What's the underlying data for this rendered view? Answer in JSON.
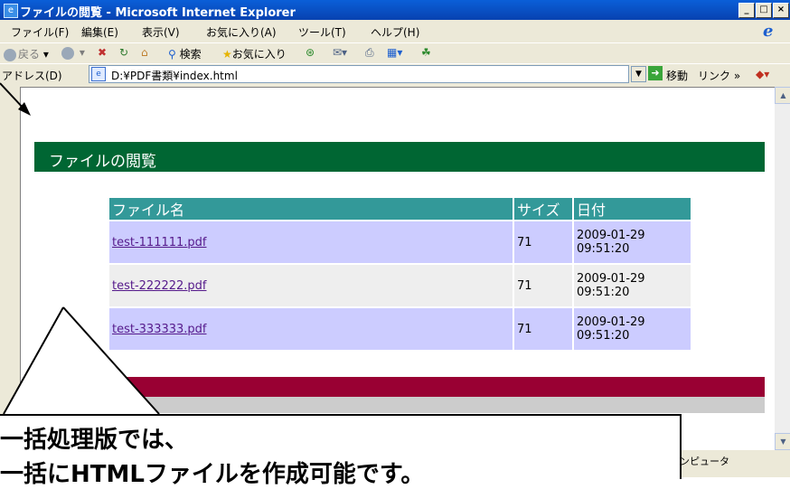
{
  "window": {
    "title": "ファイルの閲覧 - Microsoft Internet Explorer",
    "controls": [
      "_",
      "□",
      "×"
    ]
  },
  "menu": [
    "ファイル(F)",
    "編集(E)",
    "表示(V)",
    "お気に入り(A)",
    "ツール(T)",
    "ヘルプ(H)"
  ],
  "toolbar": {
    "back": "戻る",
    "search": "検索",
    "favorites": "お気に入り"
  },
  "address": {
    "label": "アドレス(D)",
    "url": "D:¥PDF書類¥index.html",
    "go": "移動",
    "links": "リンク »"
  },
  "page": {
    "heading": "ファイルの閲覧",
    "columns": [
      "ファイル名",
      "サイズ",
      "日付"
    ],
    "rows": [
      {
        "name": "test-111111.pdf",
        "size": "71",
        "date": "2009-01-29",
        "time": "09:51:20"
      },
      {
        "name": "test-222222.pdf",
        "size": "71",
        "date": "2009-01-29",
        "time": "09:51:20"
      },
      {
        "name": "test-333333.pdf",
        "size": "71",
        "date": "2009-01-29",
        "time": "09:51:20"
      }
    ]
  },
  "status": {
    "zone": "ンピュータ"
  },
  "callout": {
    "line1": "一括処理版では、",
    "line2": "一括にHTMLファイルを作成可能です。"
  }
}
